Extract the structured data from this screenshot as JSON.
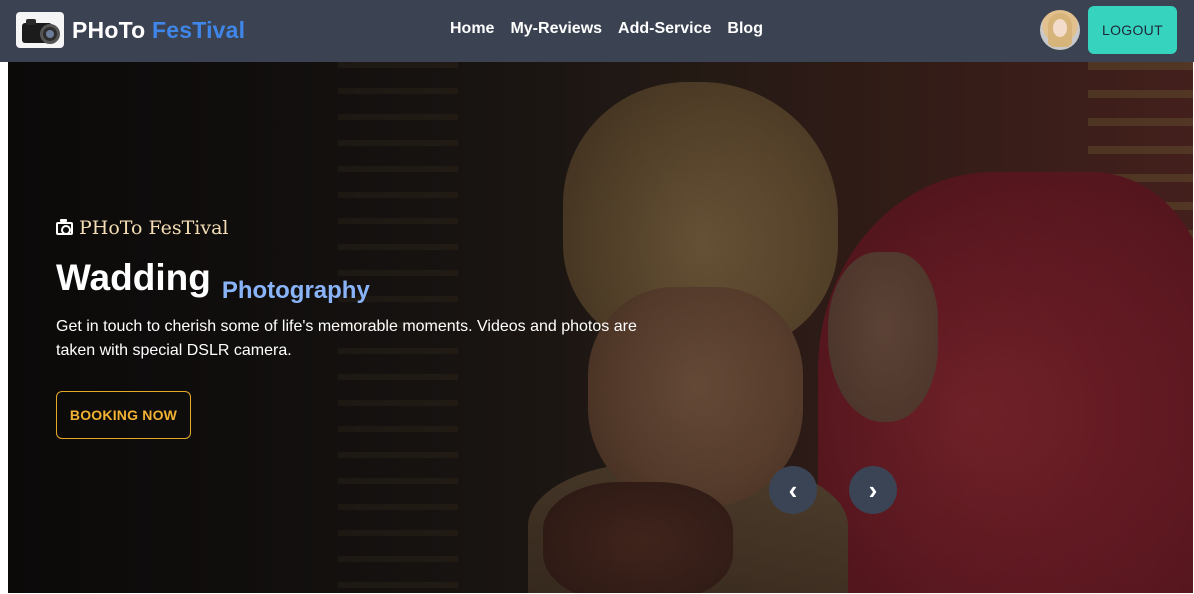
{
  "navbar": {
    "brand_main": "PHoTo",
    "brand_accent": "FesTival",
    "links": [
      "Home",
      "My-Reviews",
      "Add-Service",
      "Blog"
    ],
    "logout_label": "LOGOUT"
  },
  "hero": {
    "subtitle": "PHoTo FesTival",
    "title_main": "Wadding",
    "title_sub": "Photography",
    "description": "Get in touch to cherish some of life's memorable moments. Videos and photos are taken with special DSLR camera.",
    "cta_label": "BOOKING NOW",
    "prev_symbol": "‹",
    "next_symbol": "›"
  },
  "colors": {
    "navbar_bg": "#3b4252",
    "brand_accent": "#3f86e8",
    "logout_bg": "#36d3bf",
    "cta_border": "#e6a92a",
    "title_sub": "#8ab4f8",
    "carousel_btn_bg": "#3b4455"
  },
  "icons": {
    "logo": "camera-logo-icon",
    "subtitle": "camera-icon",
    "avatar": "user-avatar"
  }
}
